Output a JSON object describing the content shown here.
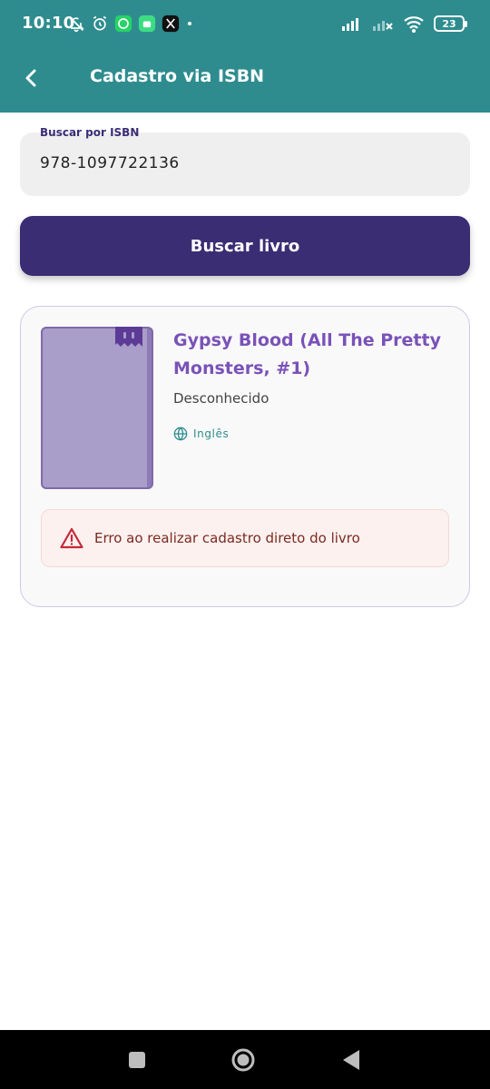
{
  "status_bar": {
    "time": "10:10",
    "battery": "23"
  },
  "app_bar": {
    "title": "Cadastro via ISBN"
  },
  "search": {
    "label": "Buscar por ISBN",
    "value": "978-1097722136"
  },
  "search_button": {
    "label": "Buscar livro"
  },
  "result": {
    "title": "Gypsy Blood (All The Pretty Monsters, #1)",
    "author": "Desconhecido",
    "language": "Inglês"
  },
  "error": {
    "message": "Erro ao realizar cadastro direto do livro"
  },
  "colors": {
    "primary": "#2e8c8f",
    "button": "#3a2d73",
    "title": "#7a52b8",
    "error": "#c62838"
  }
}
